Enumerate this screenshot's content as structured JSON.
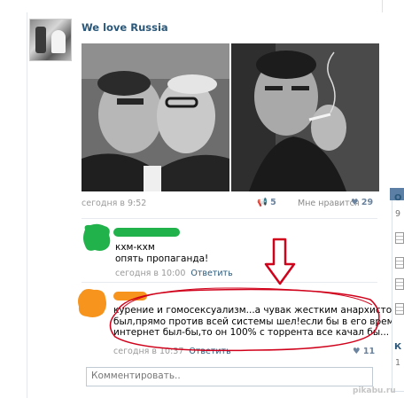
{
  "post": {
    "author": "We love Russia",
    "time": "сегодня в 9:52",
    "reposts": "5",
    "like_label": "Мне нравится",
    "likes": "29"
  },
  "comments": [
    {
      "lines": [
        "кхм-кхм",
        "опять пропаганда!"
      ],
      "time": "сегодня в 10:00",
      "reply": "Ответить",
      "avatar_color": "#21b24c"
    },
    {
      "lines": [
        "курение и гомосексуализм...а чувак жестким анархистом",
        "был,прямо против всей системы шел!если бы в его время",
        "интернет был-бы,то он 100% с торрента все качал бы..."
      ],
      "time": "сегодня в 10:37",
      "reply": "Ответить",
      "likes": "11",
      "avatar_color": "#f7941d"
    }
  ],
  "comment_input": {
    "placeholder": "Комментировать.."
  },
  "sidebar": {
    "letters": [
      "О",
      "К"
    ],
    "numbers": [
      "9",
      "1"
    ]
  },
  "watermark": "pikabu.ru",
  "colors": {
    "link": "#2b587a",
    "annotation": "#d0021b"
  }
}
